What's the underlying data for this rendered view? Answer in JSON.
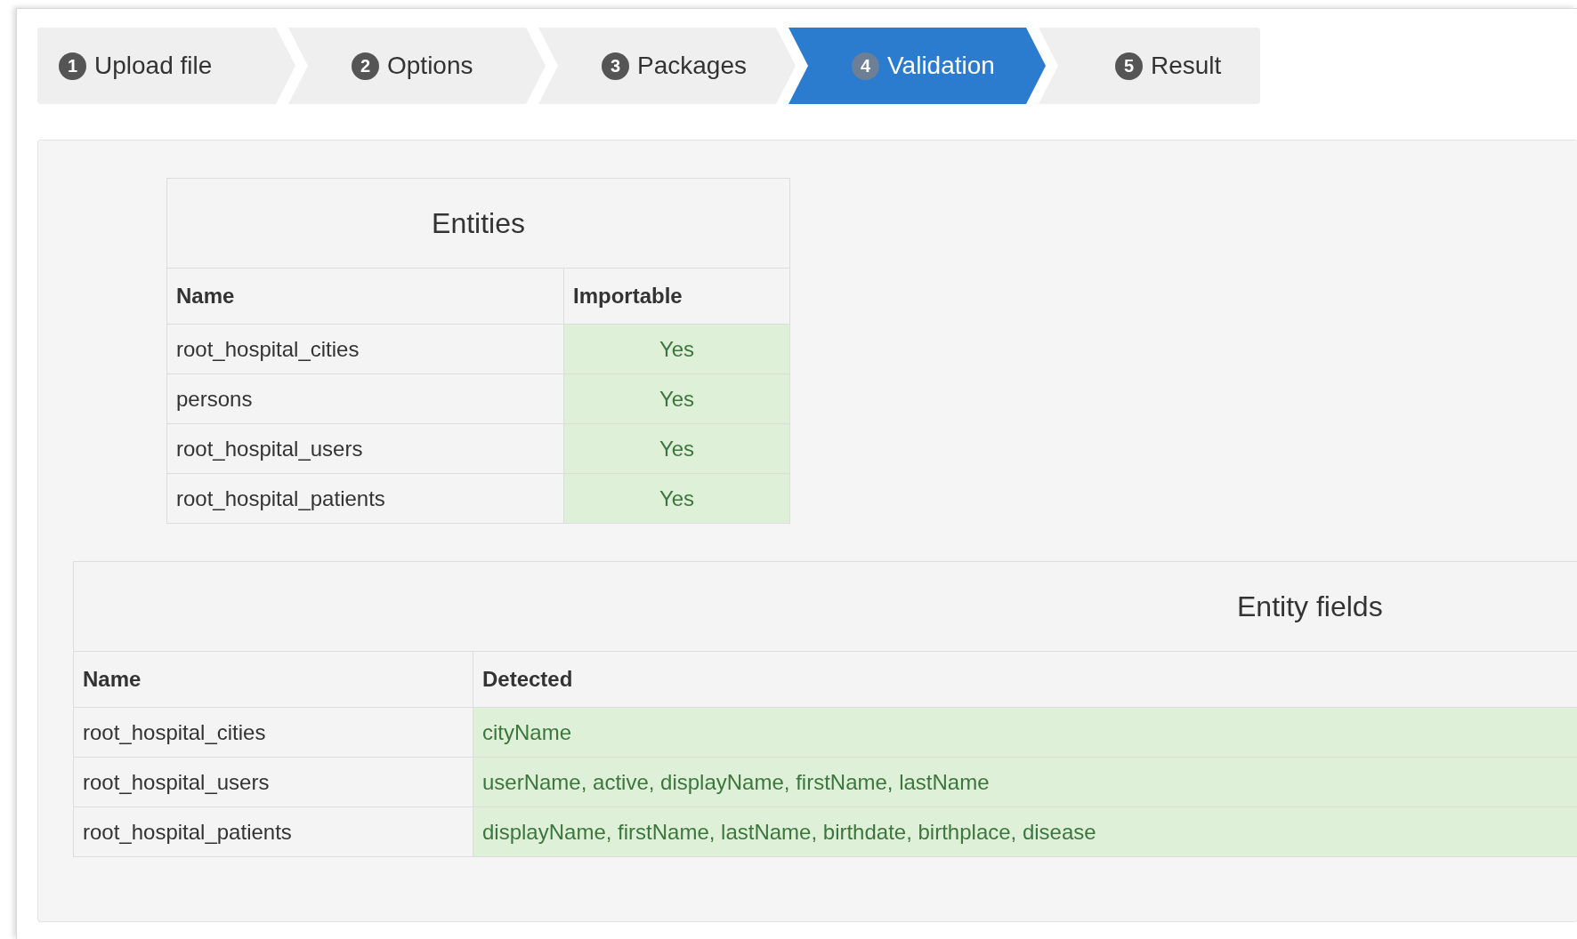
{
  "steps": [
    {
      "number": "1",
      "label": "Upload file",
      "selected": false
    },
    {
      "number": "2",
      "label": "Options",
      "selected": false
    },
    {
      "number": "3",
      "label": "Packages",
      "selected": false
    },
    {
      "number": "4",
      "label": "Validation",
      "selected": true
    },
    {
      "number": "5",
      "label": "Result",
      "selected": false
    }
  ],
  "entities": {
    "title": "Entities",
    "columns": [
      "Name",
      "Importable"
    ],
    "rows": [
      {
        "name": "root_hospital_cities",
        "importable": "Yes"
      },
      {
        "name": "persons",
        "importable": "Yes"
      },
      {
        "name": "root_hospital_users",
        "importable": "Yes"
      },
      {
        "name": "root_hospital_patients",
        "importable": "Yes"
      }
    ]
  },
  "entity_fields": {
    "title": "Entity fields",
    "columns": [
      "Name",
      "Detected"
    ],
    "rows": [
      {
        "name": "root_hospital_cities",
        "detected": "cityName"
      },
      {
        "name": "root_hospital_users",
        "detected": "userName, active, displayName, firstName, lastName"
      },
      {
        "name": "root_hospital_patients",
        "detected": "displayName, firstName, lastName, birthdate, birthplace, disease"
      }
    ]
  }
}
